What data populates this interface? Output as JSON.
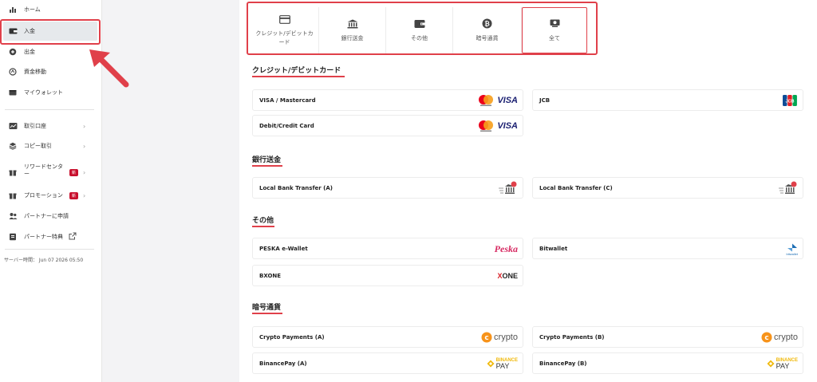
{
  "sidebar": {
    "items": [
      {
        "label": "ホーム",
        "icon": "chart-icon"
      },
      {
        "label": "入金",
        "icon": "wallet-deposit-icon",
        "active": true
      },
      {
        "label": "出金",
        "icon": "withdraw-icon"
      },
      {
        "label": "資金移動",
        "icon": "transfer-icon"
      },
      {
        "label": "マイウォレット",
        "icon": "wallet-icon"
      },
      {
        "label": "取引口座",
        "icon": "trading-account-icon"
      },
      {
        "label": "コピー取引",
        "icon": "copy-trade-icon"
      },
      {
        "label": "リワードセンター",
        "icon": "gift-icon",
        "badge": "新"
      },
      {
        "label": "プロモーション",
        "icon": "promotion-icon",
        "badge": "新"
      },
      {
        "label": "パートナーに申請",
        "icon": "partner-icon"
      },
      {
        "label": "パートナー特典",
        "icon": "benefit-icon"
      }
    ],
    "server_time": "サーバー時間： Jun 07 2026 05:50"
  },
  "tabs": [
    {
      "label": "クレジット/デビットカード",
      "icon": "credit-card-icon"
    },
    {
      "label": "銀行送金",
      "icon": "bank-icon"
    },
    {
      "label": "その他",
      "icon": "wallet-other-icon"
    },
    {
      "label": "暗号通貨",
      "icon": "bitcoin-icon"
    },
    {
      "label": "全て",
      "icon": "all-icon",
      "selected": true
    }
  ],
  "sections": {
    "card": {
      "title": "クレジット/デビットカード",
      "methods": [
        "VISA / Mastercard",
        "JCB",
        "Debit/Credit Card"
      ]
    },
    "bank": {
      "title": "銀行送金",
      "methods": [
        "Local Bank Transfer (A)",
        "Local Bank Transfer (C)"
      ]
    },
    "other": {
      "title": "その他",
      "methods": [
        "PESKA e-Wallet",
        "Bitwallet",
        "BXONE"
      ]
    },
    "crypto": {
      "title": "暗号通貨",
      "methods": [
        "Crypto Payments (A)",
        "Crypto Payments (B)",
        "BinancePay (A)",
        "BinancePay (B)"
      ]
    }
  },
  "logos": {
    "visa": "VISA",
    "jcb": "JCB",
    "crypto": "crypto",
    "binance_top": "BINANCE",
    "binance_bottom": "PAY",
    "peska": "Peska",
    "bitwallet": "bitwallet",
    "bxone_x": "X",
    "bxone_rest": "ONE"
  },
  "colors": {
    "accent": "#e0404a",
    "badge": "#c8102e",
    "binance": "#f0b90b",
    "crypto": "#f7931a",
    "visa": "#1a1f71"
  }
}
